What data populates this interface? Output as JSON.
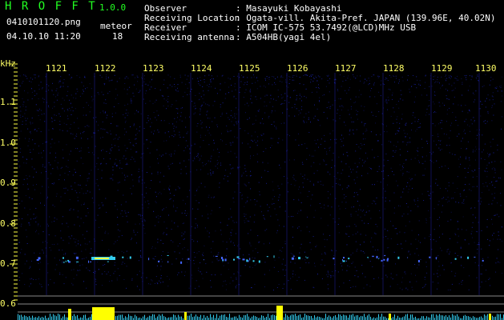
{
  "header": {
    "app_name": "H R O F F T",
    "version": "1.0.0",
    "filename": "0410101120.png",
    "datetime": "04.10.10 11:20",
    "meteor_label": "meteor",
    "meteor_count": "18",
    "info_labels": [
      "Observer",
      "Receiving Location",
      "Receiver",
      "Receiving antenna"
    ],
    "info_values": [
      ": Masayuki Kobayashi",
      ": Ogata-vill. Akita-Pref. JAPAN (139.96E, 40.02N)",
      ": ICOM IC-575 53.7492(@LCD)MHz USB",
      ": A504HB(yagi 4el)"
    ]
  },
  "axis": {
    "unit": "kHz",
    "y_ticks": [
      "1.1",
      "1.0",
      "0.9",
      "0.8",
      "0.7",
      "0.6"
    ],
    "x_ticks": [
      "1121",
      "1122",
      "1123",
      "1124",
      "1125",
      "1126",
      "1127",
      "1128",
      "1129",
      "1130"
    ]
  },
  "colors": {
    "text_green": "#22ff22",
    "text_white": "#ffffff",
    "text_yellow": "#ffff66",
    "noise_blue": "#1a22aa",
    "echo_cyan": "#33ccee",
    "bar_yellow": "#ffff00"
  }
}
